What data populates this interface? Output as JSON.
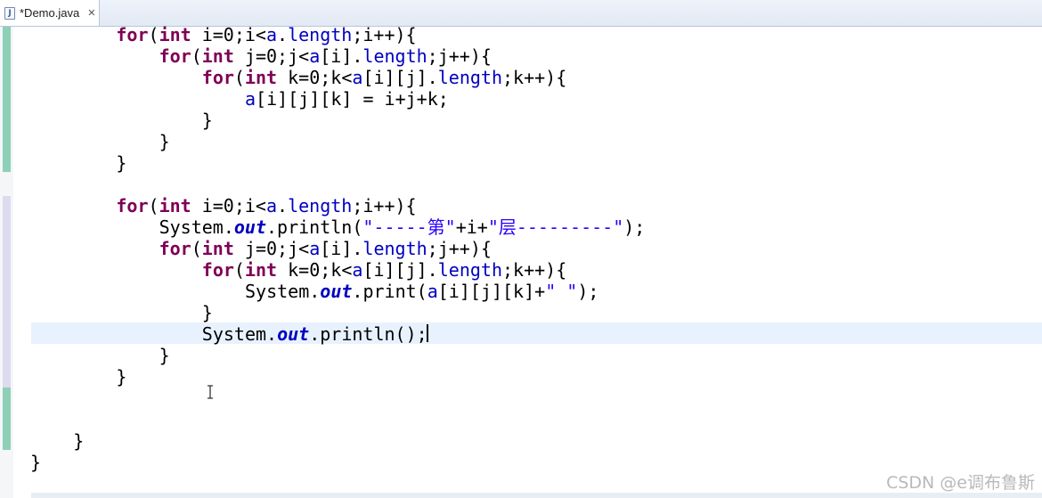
{
  "tab": {
    "icon_letter": "J",
    "label": "*Demo.java",
    "close_glyph": "✕"
  },
  "code": [
    {
      "indent": 8,
      "tokens": [
        {
          "t": "for",
          "c": "kw"
        },
        {
          "t": "("
        },
        {
          "t": "int",
          "c": "kw"
        },
        {
          "t": " i=0;i<"
        },
        {
          "t": "a",
          "c": "fld"
        },
        {
          "t": "."
        },
        {
          "t": "length",
          "c": "fld"
        },
        {
          "t": ";i++){"
        }
      ]
    },
    {
      "indent": 12,
      "tokens": [
        {
          "t": "for",
          "c": "kw"
        },
        {
          "t": "("
        },
        {
          "t": "int",
          "c": "kw"
        },
        {
          "t": " j=0;j<"
        },
        {
          "t": "a",
          "c": "fld"
        },
        {
          "t": "[i]."
        },
        {
          "t": "length",
          "c": "fld"
        },
        {
          "t": ";j++){"
        }
      ]
    },
    {
      "indent": 16,
      "tokens": [
        {
          "t": "for",
          "c": "kw"
        },
        {
          "t": "("
        },
        {
          "t": "int",
          "c": "kw"
        },
        {
          "t": " k=0;k<"
        },
        {
          "t": "a",
          "c": "fld"
        },
        {
          "t": "[i][j]."
        },
        {
          "t": "length",
          "c": "fld"
        },
        {
          "t": ";k++){"
        }
      ]
    },
    {
      "indent": 20,
      "tokens": [
        {
          "t": "a",
          "c": "fld"
        },
        {
          "t": "[i][j][k] = i+j+k;"
        }
      ]
    },
    {
      "indent": 16,
      "tokens": [
        {
          "t": "}"
        }
      ]
    },
    {
      "indent": 12,
      "tokens": [
        {
          "t": "}"
        }
      ]
    },
    {
      "indent": 8,
      "tokens": [
        {
          "t": "}"
        }
      ]
    },
    {
      "indent": 0,
      "tokens": []
    },
    {
      "indent": 8,
      "tokens": [
        {
          "t": "for",
          "c": "kw"
        },
        {
          "t": "("
        },
        {
          "t": "int",
          "c": "kw"
        },
        {
          "t": " i=0;i<"
        },
        {
          "t": "a",
          "c": "fld"
        },
        {
          "t": "."
        },
        {
          "t": "length",
          "c": "fld"
        },
        {
          "t": ";i++){"
        }
      ]
    },
    {
      "indent": 12,
      "tokens": [
        {
          "t": "System."
        },
        {
          "t": "out",
          "c": "sfld"
        },
        {
          "t": ".println("
        },
        {
          "t": "\"-----第\"",
          "c": "str"
        },
        {
          "t": "+i+"
        },
        {
          "t": "\"层---------\"",
          "c": "str"
        },
        {
          "t": ");"
        }
      ]
    },
    {
      "indent": 12,
      "tokens": [
        {
          "t": "for",
          "c": "kw"
        },
        {
          "t": "("
        },
        {
          "t": "int",
          "c": "kw"
        },
        {
          "t": " j=0;j<"
        },
        {
          "t": "a",
          "c": "fld"
        },
        {
          "t": "[i]."
        },
        {
          "t": "length",
          "c": "fld"
        },
        {
          "t": ";j++){"
        }
      ]
    },
    {
      "indent": 16,
      "tokens": [
        {
          "t": "for",
          "c": "kw"
        },
        {
          "t": "("
        },
        {
          "t": "int",
          "c": "kw"
        },
        {
          "t": " k=0;k<"
        },
        {
          "t": "a",
          "c": "fld"
        },
        {
          "t": "[i][j]."
        },
        {
          "t": "length",
          "c": "fld"
        },
        {
          "t": ";k++){"
        }
      ]
    },
    {
      "indent": 20,
      "tokens": [
        {
          "t": "System."
        },
        {
          "t": "out",
          "c": "sfld"
        },
        {
          "t": ".print("
        },
        {
          "t": "a",
          "c": "fld"
        },
        {
          "t": "[i][j][k]+"
        },
        {
          "t": "\" \"",
          "c": "str"
        },
        {
          "t": ");"
        }
      ]
    },
    {
      "indent": 16,
      "tokens": [
        {
          "t": "}"
        }
      ]
    },
    {
      "indent": 16,
      "tokens": [
        {
          "t": "System."
        },
        {
          "t": "out",
          "c": "sfld"
        },
        {
          "t": ".println();"
        }
      ]
    },
    {
      "indent": 12,
      "tokens": [
        {
          "t": "}"
        }
      ]
    },
    {
      "indent": 8,
      "tokens": [
        {
          "t": "}"
        }
      ]
    },
    {
      "indent": 0,
      "tokens": []
    },
    {
      "indent": 0,
      "tokens": []
    },
    {
      "indent": 4,
      "tokens": [
        {
          "t": "}"
        }
      ]
    },
    {
      "indent": 0,
      "tokens": [
        {
          "t": "}"
        }
      ]
    }
  ],
  "watermark": "CSDN @e调布鲁斯",
  "colors": {
    "keyword": "#7f0055",
    "field": "#0000c0",
    "string": "#2a00ff",
    "current_line": "#e8f2fe",
    "ruler_change": "#8ecfb8",
    "ruler_add": "#dcdcf0"
  }
}
